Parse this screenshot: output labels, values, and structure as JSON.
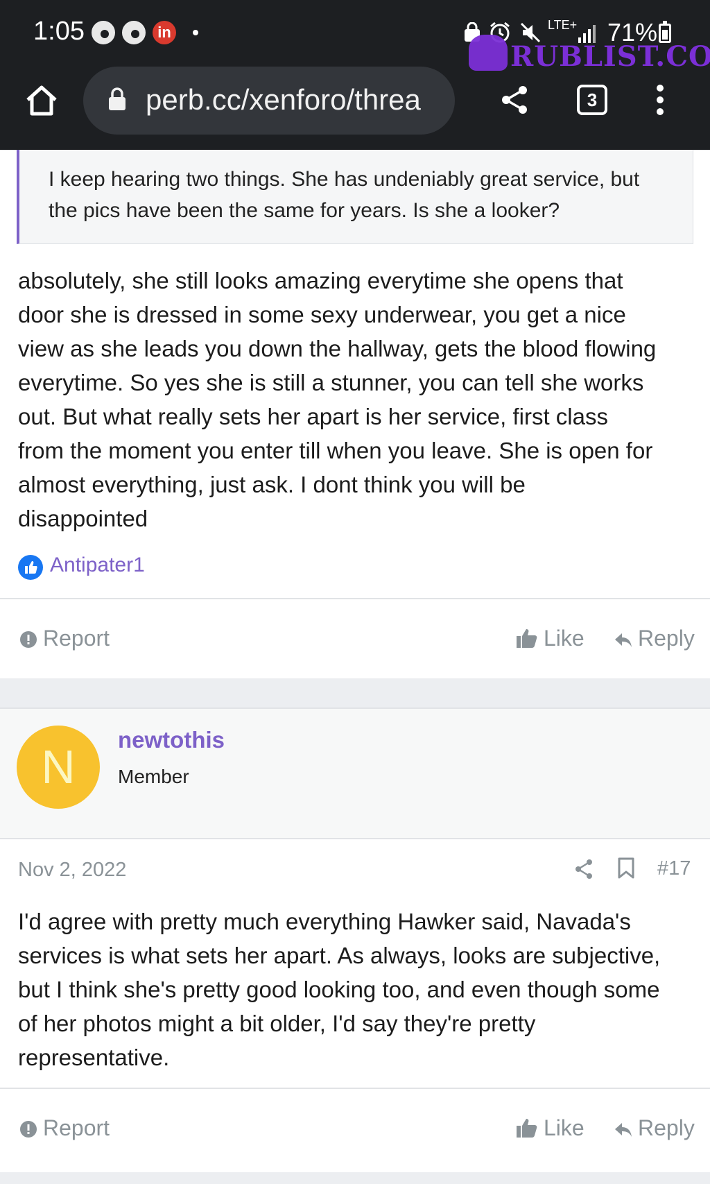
{
  "status_bar": {
    "time": "1:05",
    "network": "LTE+",
    "battery": "71%",
    "notification_app": "in"
  },
  "watermark": "RUBLIST.COM",
  "browser": {
    "url": "perb.cc/xenforo/threa",
    "tab_count": "3"
  },
  "post1": {
    "quote": "I keep hearing two things. She has undeniably great service, but the pics have been the same for years. Is she a looker?",
    "body_lines": [
      "absolutely, she still looks amazing everytime she opens that",
      "door she is dressed in some sexy underwear, you get a nice",
      "view as she leads you down the hallway, gets the blood flowing",
      "everytime. So yes she is still a stunner, you can tell she works",
      "out. But what really sets her apart is her service, first class",
      "from the moment you enter till when you leave. She is open for",
      "almost everything, just ask. I dont think you will be",
      "disappointed"
    ],
    "reaction_user": "Antipater1",
    "actions": {
      "report": "Report",
      "like": "Like",
      "reply": "Reply"
    }
  },
  "post2": {
    "avatar_letter": "N",
    "username": "newtothis",
    "user_title": "Member",
    "date": "Nov 2, 2022",
    "post_number": "#17",
    "body_lines": [
      "I'd agree with pretty much everything Hawker said, Navada's",
      "services is what sets her apart. As always, looks are subjective,",
      "but I think she's pretty good looking too, and even though some",
      "of her photos might a bit older, I'd say they're pretty",
      "representative."
    ],
    "actions": {
      "report": "Report",
      "like": "Like",
      "reply": "Reply"
    }
  },
  "colors": {
    "chrome_bg": "#1d1f22",
    "accent": "#7d61c8",
    "muted": "#8a9297",
    "avatar": "#f8c22e"
  }
}
